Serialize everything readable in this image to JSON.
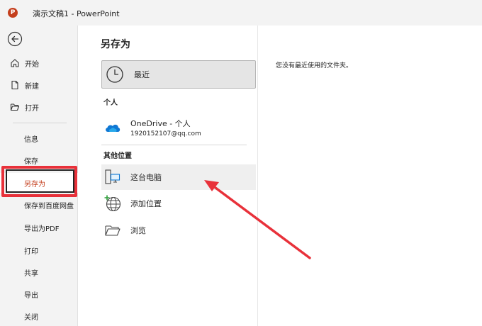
{
  "window": {
    "title": "演示文稿1  -  PowerPoint",
    "app_logo": "P"
  },
  "sidebar": {
    "back_icon": "back-arrow-icon",
    "items": [
      {
        "label": "开始",
        "icon": "home-icon"
      },
      {
        "label": "新建",
        "icon": "new-document-icon"
      },
      {
        "label": "打开",
        "icon": "open-folder-icon"
      },
      {
        "label": "信息"
      },
      {
        "label": "保存"
      },
      {
        "label": "另存为"
      },
      {
        "label": "保存到百度网盘"
      },
      {
        "label": "导出为PDF"
      },
      {
        "label": "打印"
      },
      {
        "label": "共享"
      },
      {
        "label": "导出"
      },
      {
        "label": "关闭"
      }
    ],
    "selected": "另存为"
  },
  "main": {
    "title": "另存为",
    "recent": {
      "label": "最近",
      "icon": "clock-icon"
    },
    "personal_section": "个人",
    "onedrive": {
      "label": "OneDrive - 个人",
      "account": "1920152107@qq.com",
      "icon": "onedrive-cloud-icon"
    },
    "other_section": "其他位置",
    "locations": [
      {
        "label": "这台电脑",
        "icon": "this-pc-icon"
      },
      {
        "label": "添加位置",
        "icon": "add-location-globe-icon"
      },
      {
        "label": "浏览",
        "icon": "browse-folder-icon"
      }
    ]
  },
  "right_panel": {
    "empty_message": "您没有最近使用的文件夹。"
  },
  "annotation": {
    "color": "#e8313a"
  }
}
